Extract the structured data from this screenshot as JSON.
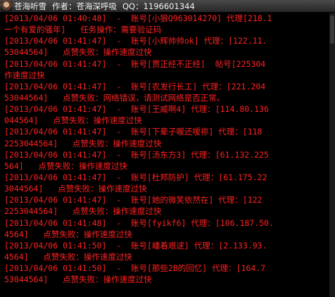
{
  "titlebar": {
    "name": "苍海听雪",
    "author": "作者：苍海深呼吸",
    "qq": "QQ：1196601344"
  },
  "console": {
    "text_color": "#ff2020",
    "lines": [
      "[2013/04/06 01:40:48]  -  账号[小狼Q963014270] 代理[218.1",
      "一个有爱的骚年]   任务操作：需要验证码",
      "[2013/04/06 01:41:47]  -  账号[小辉帅帅ok] 代理：[122.11.",
      "53044564]   点赞失败：操作速度过快",
      "[2013/04/06 01:41:47]  -  账号[贾正经不正经]  帖号[225304",
      "作速度过快",
      "[2013/04/06 01:41:47]  -  账号[农发行长工] 代理：[221.204",
      "53044564]   点赞失败：网络错误，请测试网络是否正常。",
      "[2013/04/06 01:41:47]  -  账号[王威啊4] 代理：[114.80.136",
      "044564]   点赞失败：操作速度过快",
      "[2013/04/06 01:41:47]  -  账号[下辈子喔还嗳祢] 代理：[118",
      "2253044564]   点赞失败：操作速度过快",
      "[2013/04/06 01:41:47]  -  账号[汤东方3] 代理：[61.132.225",
      "564]   点赞失败：操作速度过快",
      "[2013/04/06 01:41:47]  -  账号[杜邦防护] 代理：[61.175.22",
      "3044564]   点赞失败：操作速度过快",
      "[2013/04/06 01:41:47]  -  账号[她的微笑依然在] 代理：[122",
      "2253044564]   点赞失败：操作速度过快",
      "[2013/04/06 01:41:48]  -  账号[fyikf6] 代理：[106.187.50.",
      "4564]   点赞失败：操作速度过快",
      "[2013/04/06 01:41:50]  -  账号[嶓着艰逑] 代理：[2.133.93.",
      "4564]   点赞失败：操作速度过快",
      "[2013/04/06 01:41:50]  -  账号[那些2B的回忆] 代理：[164.7",
      "53044564]   点赞失败：操作速度过快"
    ]
  }
}
